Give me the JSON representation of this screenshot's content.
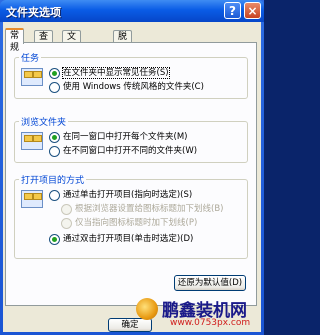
{
  "window": {
    "title": "文件夹选项",
    "help_glyph": "?",
    "close_glyph": "×"
  },
  "tabs": [
    {
      "label": "常规",
      "active": true
    },
    {
      "label": "查看",
      "active": false
    },
    {
      "label": "文件类型",
      "active": false
    },
    {
      "label": "脱机文件",
      "active": false
    }
  ],
  "groups": {
    "tasks": {
      "title": "任务",
      "options": [
        {
          "label": "在文件夹中显示常见任务(S)",
          "checked": true
        },
        {
          "label": "使用 Windows 传统风格的文件夹(C)",
          "checked": false
        }
      ]
    },
    "browse": {
      "title": "浏览文件夹",
      "options": [
        {
          "label": "在同一窗口中打开每个文件夹(M)",
          "checked": true
        },
        {
          "label": "在不同窗口中打开不同的文件夹(W)",
          "checked": false
        }
      ]
    },
    "click": {
      "title": "打开项目的方式",
      "options": [
        {
          "label": "通过单击打开项目(指向时选定)(S)",
          "checked": false,
          "disabled": false
        },
        {
          "label": "根据浏览器设置给图标标题加下划线(B)",
          "checked": false,
          "disabled": true
        },
        {
          "label": "仅当指向图标标题时加下划线(P)",
          "checked": false,
          "disabled": true
        },
        {
          "label": "通过双击打开项目(单击时选定)(D)",
          "checked": true,
          "disabled": false
        }
      ]
    }
  },
  "buttons": {
    "restore_defaults": "还原为默认值(D)",
    "ok": "确定"
  },
  "watermark": {
    "name": "鹏鑫装机网",
    "url": "www.0753px.com"
  },
  "colors": {
    "titlebar": "#0a5ce6",
    "group_title": "#0046d5",
    "tab_highlight": "#e68b2c",
    "watermark_url": "#d01c1c"
  }
}
